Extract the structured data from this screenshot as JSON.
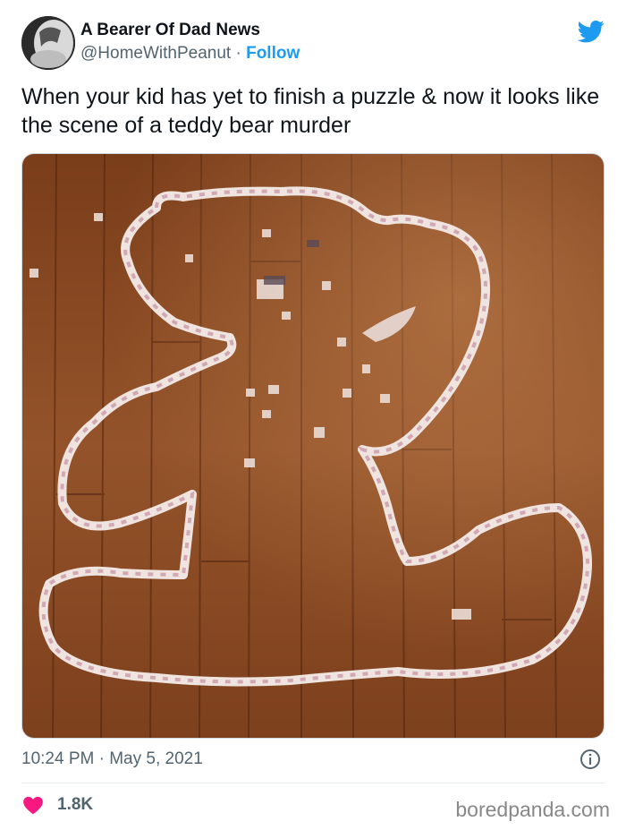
{
  "tweet": {
    "display_name": "A Bearer Of Dad News",
    "handle": "@HomeWithPeanut",
    "separator": "·",
    "follow_label": "Follow",
    "text": "When your kid has yet to finish a puzzle & now it looks like the scene of a teddy bear murder",
    "time": "10:24 PM",
    "date_separator": "·",
    "date": "May 5, 2021",
    "like_count": "1.8K"
  },
  "icons": {
    "brand": "twitter-bird-icon",
    "info": "info-icon",
    "like": "heart-icon"
  },
  "colors": {
    "accent": "#1d9bf0",
    "heart": "#f91880",
    "muted": "#536471",
    "floor": "#8a4a24"
  },
  "watermark": "boredpanda.com"
}
